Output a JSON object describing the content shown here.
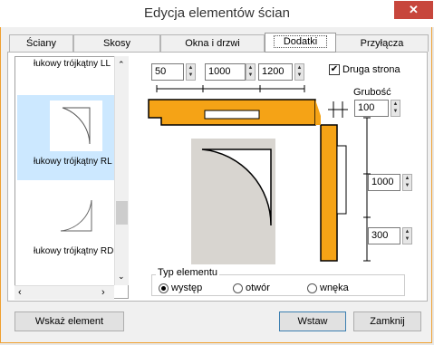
{
  "window": {
    "title": "Edycja elementów ścian",
    "close_label": "✕"
  },
  "tabs": [
    {
      "label": "Ściany"
    },
    {
      "label": "Skosy"
    },
    {
      "label": "Okna i drzwi"
    },
    {
      "label": "Dodatki"
    },
    {
      "label": "Przyłącza"
    }
  ],
  "list": {
    "items": [
      {
        "label": "łukowy trójkątny LL"
      },
      {
        "label": "łukowy trójkątny RL"
      },
      {
        "label": "łukowy trójkątny RD"
      }
    ],
    "selected_index": 1
  },
  "dimensions": {
    "a": "50",
    "b": "1000",
    "c": "1200",
    "thickness_label": "Grubość",
    "thickness": "100",
    "height": "1000",
    "bottom": "300"
  },
  "options": {
    "second_side_label": "Druga strona",
    "second_side_checked": true
  },
  "element_type": {
    "legend": "Typ elementu",
    "options": [
      {
        "label": "występ",
        "selected": true
      },
      {
        "label": "otwór",
        "selected": false
      },
      {
        "label": "wnęka",
        "selected": false
      }
    ]
  },
  "buttons": {
    "show_element": "Wskaż element",
    "insert": "Wstaw",
    "close": "Zamknij"
  },
  "colors": {
    "wall": "#f5a316",
    "preview_bg": "#d8d5d0",
    "selection": "#cce8ff"
  }
}
